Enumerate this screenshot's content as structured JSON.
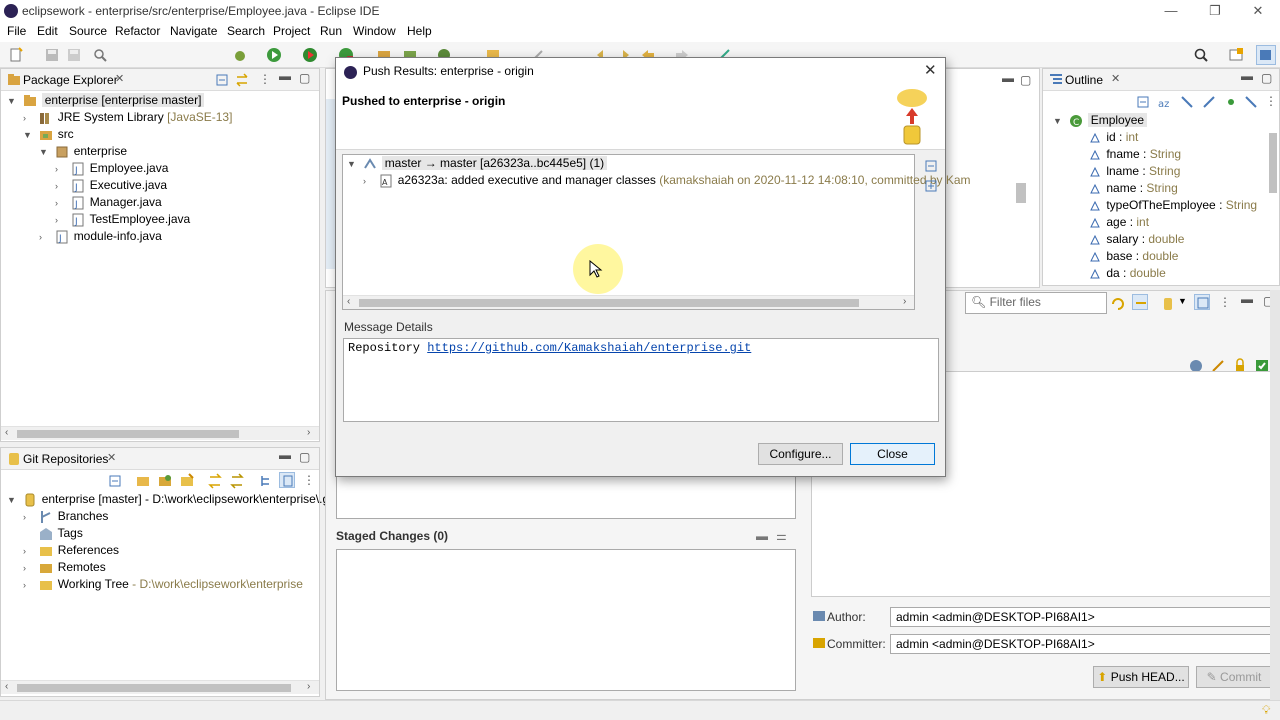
{
  "window": {
    "title": "eclipsework - enterprise/src/enterprise/Employee.java - Eclipse IDE",
    "minimize": "—",
    "restore": "❐",
    "close": "✕"
  },
  "menu": [
    "File",
    "Edit",
    "Source",
    "Refactor",
    "Navigate",
    "Search",
    "Project",
    "Run",
    "Window",
    "Help"
  ],
  "package_explorer": {
    "title": "Package Explorer",
    "project": "enterprise [enterprise master]",
    "jre": "JRE System Library",
    "jre_deco": "[JavaSE-13]",
    "src": "src",
    "package": "enterprise",
    "files": [
      "Employee.java",
      "Executive.java",
      "Manager.java",
      "TestEmployee.java"
    ],
    "module": "module-info.java"
  },
  "git_repos": {
    "title": "Git Repositories",
    "repo": "enterprise [master] - D:\\work\\eclipsework\\enterprise\\.git",
    "items": [
      "Branches",
      "Tags",
      "References",
      "Remotes"
    ],
    "working_tree": "Working Tree",
    "working_tree_path": "- D:\\work\\eclipsework\\enterprise"
  },
  "outline": {
    "title": "Outline",
    "class": "Employee",
    "fields": [
      {
        "name": "id",
        "type": "int"
      },
      {
        "name": "fname",
        "type": "String"
      },
      {
        "name": "lname",
        "type": "String"
      },
      {
        "name": "name",
        "type": "String"
      },
      {
        "name": "typeOfTheEmployee",
        "type": "String"
      },
      {
        "name": "age",
        "type": "int"
      },
      {
        "name": "salary",
        "type": "double"
      },
      {
        "name": "base",
        "type": "double"
      },
      {
        "name": "da",
        "type": "double"
      }
    ]
  },
  "filter": {
    "placeholder": "Filter files"
  },
  "staging": {
    "staged_title": "Staged Changes (0)",
    "author_label": "Author:",
    "author_value": "admin <admin@DESKTOP-PI68AI1>",
    "committer_label": "Committer:",
    "committer_value": "admin <admin@DESKTOP-PI68AI1>",
    "push_button": "Push HEAD...",
    "commit_button": "Commit"
  },
  "dialog": {
    "title": "Push Results: enterprise - origin",
    "heading": "Pushed to enterprise - origin",
    "ref_update": "master → master [a26323a..bc445e5] (1)",
    "commit_line": "a26323a: added executive and manager classes",
    "commit_meta": "(kamakshaiah on 2020-11-12 14:08:10, committed by Kam",
    "message_details_label": "Message Details",
    "repo_label": "Repository",
    "repo_url": "https://github.com/Kamakshaiah/enterprise.git",
    "configure_button": "Configure...",
    "close_button": "Close"
  },
  "colors": {
    "accent": "#0078d7",
    "selection": "#cce8ff",
    "link": "#0645ad",
    "decoration": "#8a7b4a"
  }
}
